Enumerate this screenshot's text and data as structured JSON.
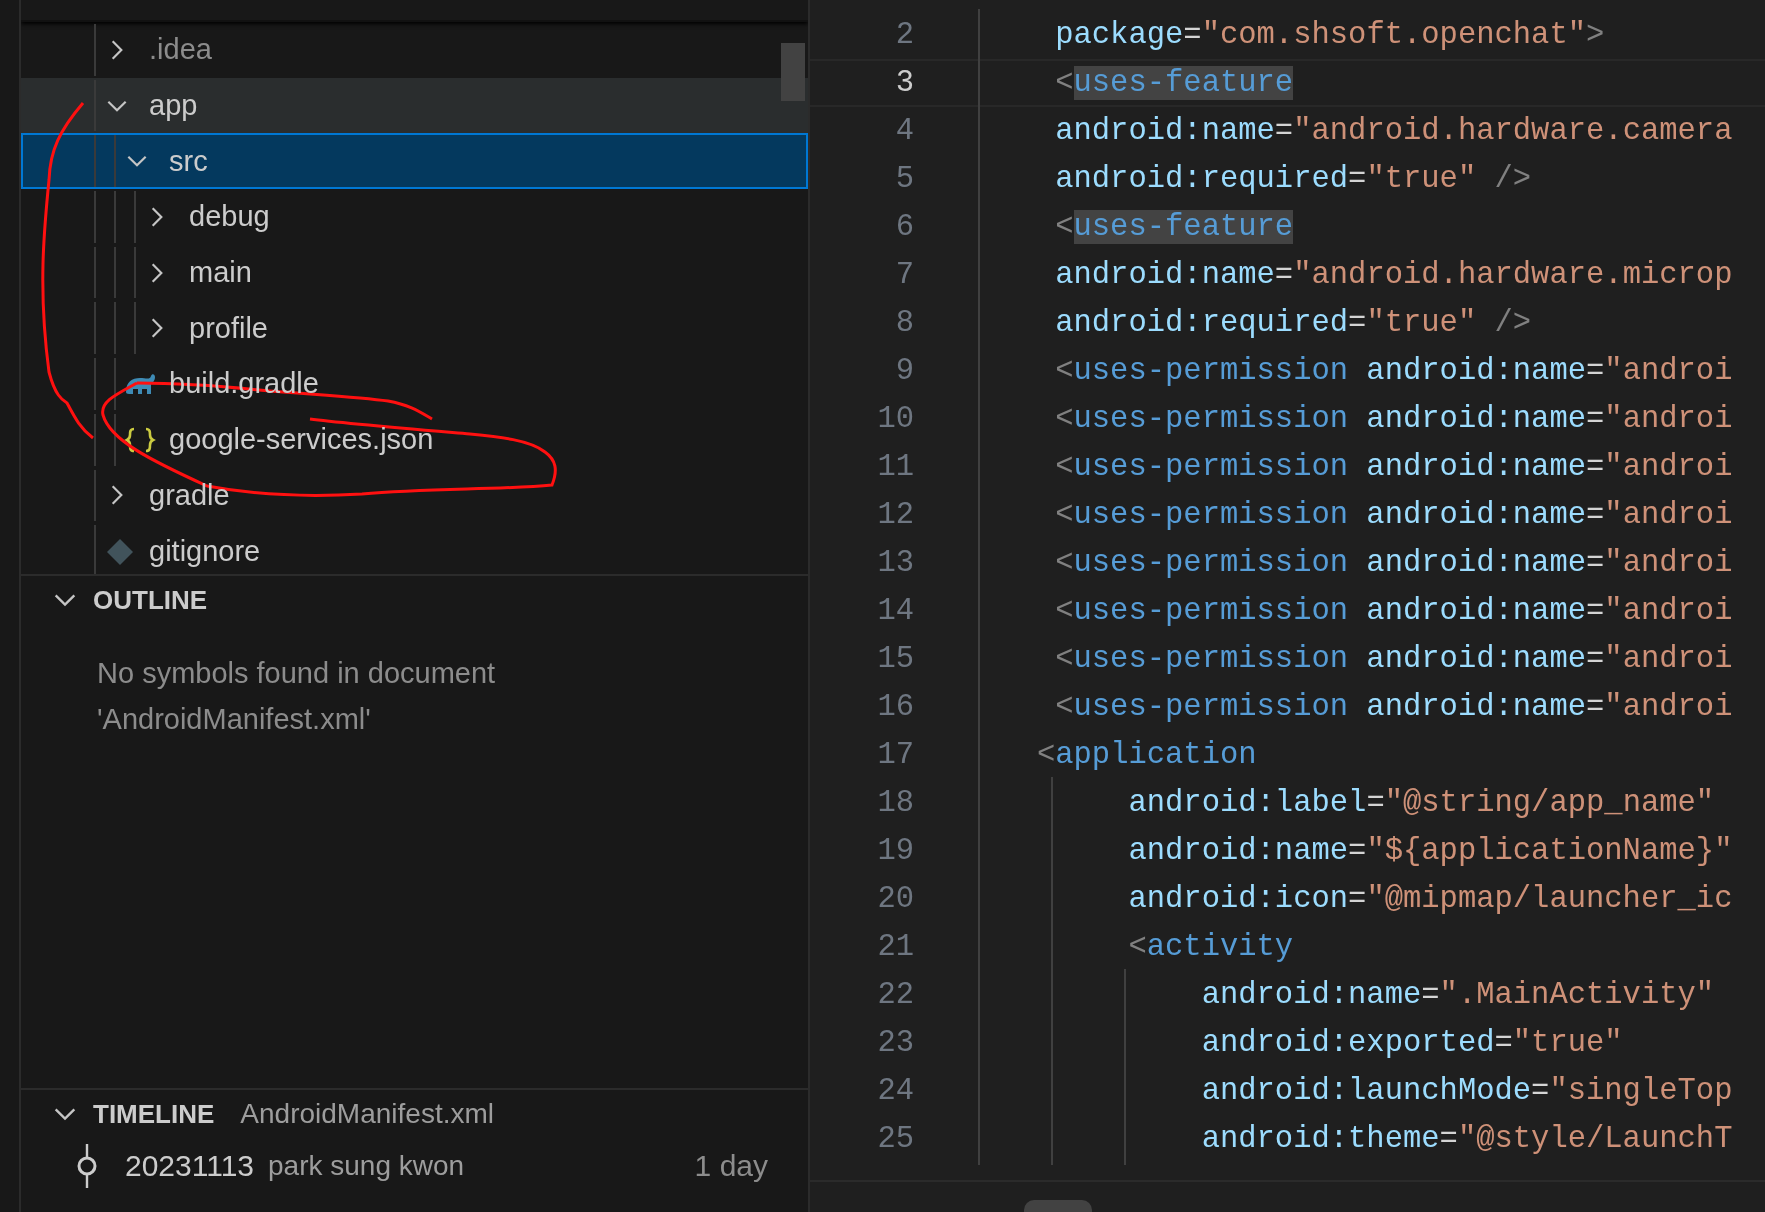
{
  "explorer": {
    "items": [
      {
        "label": ".idea",
        "kind": "folder",
        "expanded": false,
        "selected": false,
        "hovered": false,
        "dim": true
      },
      {
        "label": "app",
        "kind": "folder",
        "expanded": true,
        "selected": false,
        "hovered": true,
        "dim": false,
        "children": [
          {
            "label": "src",
            "kind": "folder",
            "expanded": true,
            "selected": true,
            "hovered": false,
            "dim": false,
            "children": [
              {
                "label": "debug",
                "kind": "folder",
                "expanded": false,
                "selected": false,
                "hovered": false,
                "dim": false
              },
              {
                "label": "main",
                "kind": "folder",
                "expanded": false,
                "selected": false,
                "hovered": false,
                "dim": false
              },
              {
                "label": "profile",
                "kind": "folder",
                "expanded": false,
                "selected": false,
                "hovered": false,
                "dim": false
              }
            ]
          },
          {
            "label": "build.gradle",
            "kind": "gradle",
            "selected": false,
            "hovered": false,
            "dim": false
          },
          {
            "label": "google-services.json",
            "kind": "json",
            "selected": false,
            "hovered": false,
            "dim": false
          }
        ]
      },
      {
        "label": "gradle",
        "kind": "folder",
        "expanded": false,
        "selected": false,
        "hovered": false,
        "dim": false
      },
      {
        "label": "gitignore",
        "kind": "git",
        "selected": false,
        "hovered": false,
        "dim": false
      }
    ]
  },
  "outline": {
    "title": "OUTLINE",
    "expanded": true,
    "message": "No symbols found in document 'AndroidManifest.xml'"
  },
  "timeline": {
    "title": "TIMELINE",
    "expanded": true,
    "file": "AndroidManifest.xml",
    "entries": [
      {
        "label": "20231113",
        "author": "park sung kwon",
        "age": "1 day"
      }
    ]
  },
  "editor": {
    "lines": [
      {
        "number": "2",
        "current": false,
        "tokens": [
          {
            "kind": "attr",
            "text": "    package"
          },
          {
            "kind": "eq",
            "text": "="
          },
          {
            "kind": "str",
            "text": "\"com.shsoft.openchat\""
          },
          {
            "kind": "punct",
            "text": ">"
          }
        ]
      },
      {
        "number": "3",
        "current": true,
        "tokens": [
          {
            "kind": "punct",
            "text": "    <"
          },
          {
            "kind": "tag",
            "text": "uses-feature",
            "highlight": true
          }
        ]
      },
      {
        "number": "4",
        "current": false,
        "tokens": [
          {
            "kind": "attr",
            "text": "    android:name"
          },
          {
            "kind": "eq",
            "text": "="
          },
          {
            "kind": "str",
            "text": "\"android.hardware.camera"
          }
        ]
      },
      {
        "number": "5",
        "current": false,
        "tokens": [
          {
            "kind": "attr",
            "text": "    android:required"
          },
          {
            "kind": "eq",
            "text": "="
          },
          {
            "kind": "str",
            "text": "\"true\""
          },
          {
            "kind": "punct",
            "text": " />"
          }
        ]
      },
      {
        "number": "6",
        "current": false,
        "tokens": [
          {
            "kind": "punct",
            "text": "    <"
          },
          {
            "kind": "tag",
            "text": "uses-feature",
            "highlight": true
          }
        ]
      },
      {
        "number": "7",
        "current": false,
        "tokens": [
          {
            "kind": "attr",
            "text": "    android:name"
          },
          {
            "kind": "eq",
            "text": "="
          },
          {
            "kind": "str",
            "text": "\"android.hardware.microp"
          }
        ]
      },
      {
        "number": "8",
        "current": false,
        "tokens": [
          {
            "kind": "attr",
            "text": "    android:required"
          },
          {
            "kind": "eq",
            "text": "="
          },
          {
            "kind": "str",
            "text": "\"true\""
          },
          {
            "kind": "punct",
            "text": " />"
          }
        ]
      },
      {
        "number": "9",
        "current": false,
        "tokens": [
          {
            "kind": "punct",
            "text": "    <"
          },
          {
            "kind": "tag",
            "text": "uses-permission"
          },
          {
            "kind": "attr",
            "text": " android:name"
          },
          {
            "kind": "eq",
            "text": "="
          },
          {
            "kind": "str",
            "text": "\"androi"
          }
        ]
      },
      {
        "number": "10",
        "current": false,
        "tokens": [
          {
            "kind": "punct",
            "text": "    <"
          },
          {
            "kind": "tag",
            "text": "uses-permission"
          },
          {
            "kind": "attr",
            "text": " android:name"
          },
          {
            "kind": "eq",
            "text": "="
          },
          {
            "kind": "str",
            "text": "\"androi"
          }
        ]
      },
      {
        "number": "11",
        "current": false,
        "tokens": [
          {
            "kind": "punct",
            "text": "    <"
          },
          {
            "kind": "tag",
            "text": "uses-permission"
          },
          {
            "kind": "attr",
            "text": " android:name"
          },
          {
            "kind": "eq",
            "text": "="
          },
          {
            "kind": "str",
            "text": "\"androi"
          }
        ]
      },
      {
        "number": "12",
        "current": false,
        "tokens": [
          {
            "kind": "punct",
            "text": "    <"
          },
          {
            "kind": "tag",
            "text": "uses-permission"
          },
          {
            "kind": "attr",
            "text": " android:name"
          },
          {
            "kind": "eq",
            "text": "="
          },
          {
            "kind": "str",
            "text": "\"androi"
          }
        ]
      },
      {
        "number": "13",
        "current": false,
        "tokens": [
          {
            "kind": "punct",
            "text": "    <"
          },
          {
            "kind": "tag",
            "text": "uses-permission"
          },
          {
            "kind": "attr",
            "text": " android:name"
          },
          {
            "kind": "eq",
            "text": "="
          },
          {
            "kind": "str",
            "text": "\"androi"
          }
        ]
      },
      {
        "number": "14",
        "current": false,
        "tokens": [
          {
            "kind": "punct",
            "text": "    <"
          },
          {
            "kind": "tag",
            "text": "uses-permission"
          },
          {
            "kind": "attr",
            "text": " android:name"
          },
          {
            "kind": "eq",
            "text": "="
          },
          {
            "kind": "str",
            "text": "\"androi"
          }
        ]
      },
      {
        "number": "15",
        "current": false,
        "tokens": [
          {
            "kind": "punct",
            "text": "    <"
          },
          {
            "kind": "tag",
            "text": "uses-permission"
          },
          {
            "kind": "attr",
            "text": " android:name"
          },
          {
            "kind": "eq",
            "text": "="
          },
          {
            "kind": "str",
            "text": "\"androi"
          }
        ]
      },
      {
        "number": "16",
        "current": false,
        "tokens": [
          {
            "kind": "punct",
            "text": "    <"
          },
          {
            "kind": "tag",
            "text": "uses-permission"
          },
          {
            "kind": "attr",
            "text": " android:name"
          },
          {
            "kind": "eq",
            "text": "="
          },
          {
            "kind": "str",
            "text": "\"androi"
          }
        ]
      },
      {
        "number": "17",
        "current": false,
        "tokens": [
          {
            "kind": "punct",
            "text": "   <"
          },
          {
            "kind": "tag",
            "text": "application"
          }
        ]
      },
      {
        "number": "18",
        "current": false,
        "tokens": [
          {
            "kind": "attr",
            "text": "        android:label"
          },
          {
            "kind": "eq",
            "text": "="
          },
          {
            "kind": "str",
            "text": "\"@string/app_name\""
          }
        ]
      },
      {
        "number": "19",
        "current": false,
        "tokens": [
          {
            "kind": "attr",
            "text": "        android:name"
          },
          {
            "kind": "eq",
            "text": "="
          },
          {
            "kind": "str",
            "text": "\"${applicationName}\""
          }
        ]
      },
      {
        "number": "20",
        "current": false,
        "tokens": [
          {
            "kind": "attr",
            "text": "        android:icon"
          },
          {
            "kind": "eq",
            "text": "="
          },
          {
            "kind": "str",
            "text": "\"@mipmap/launcher_ic"
          }
        ]
      },
      {
        "number": "21",
        "current": false,
        "tokens": [
          {
            "kind": "punct",
            "text": "        <"
          },
          {
            "kind": "tag",
            "text": "activity"
          }
        ]
      },
      {
        "number": "22",
        "current": false,
        "tokens": [
          {
            "kind": "attr",
            "text": "            android:name"
          },
          {
            "kind": "eq",
            "text": "="
          },
          {
            "kind": "str",
            "text": "\".MainActivity\""
          }
        ]
      },
      {
        "number": "23",
        "current": false,
        "tokens": [
          {
            "kind": "attr",
            "text": "            android:exported"
          },
          {
            "kind": "eq",
            "text": "="
          },
          {
            "kind": "str",
            "text": "\"true\""
          }
        ]
      },
      {
        "number": "24",
        "current": false,
        "tokens": [
          {
            "kind": "attr",
            "text": "            android:launchMode"
          },
          {
            "kind": "eq",
            "text": "="
          },
          {
            "kind": "str",
            "text": "\"singleTop"
          }
        ]
      },
      {
        "number": "25",
        "current": false,
        "tokens": [
          {
            "kind": "attr",
            "text": "            android:theme"
          },
          {
            "kind": "eq",
            "text": "="
          },
          {
            "kind": "str",
            "text": "\"@style/LaunchT"
          }
        ]
      }
    ]
  }
}
